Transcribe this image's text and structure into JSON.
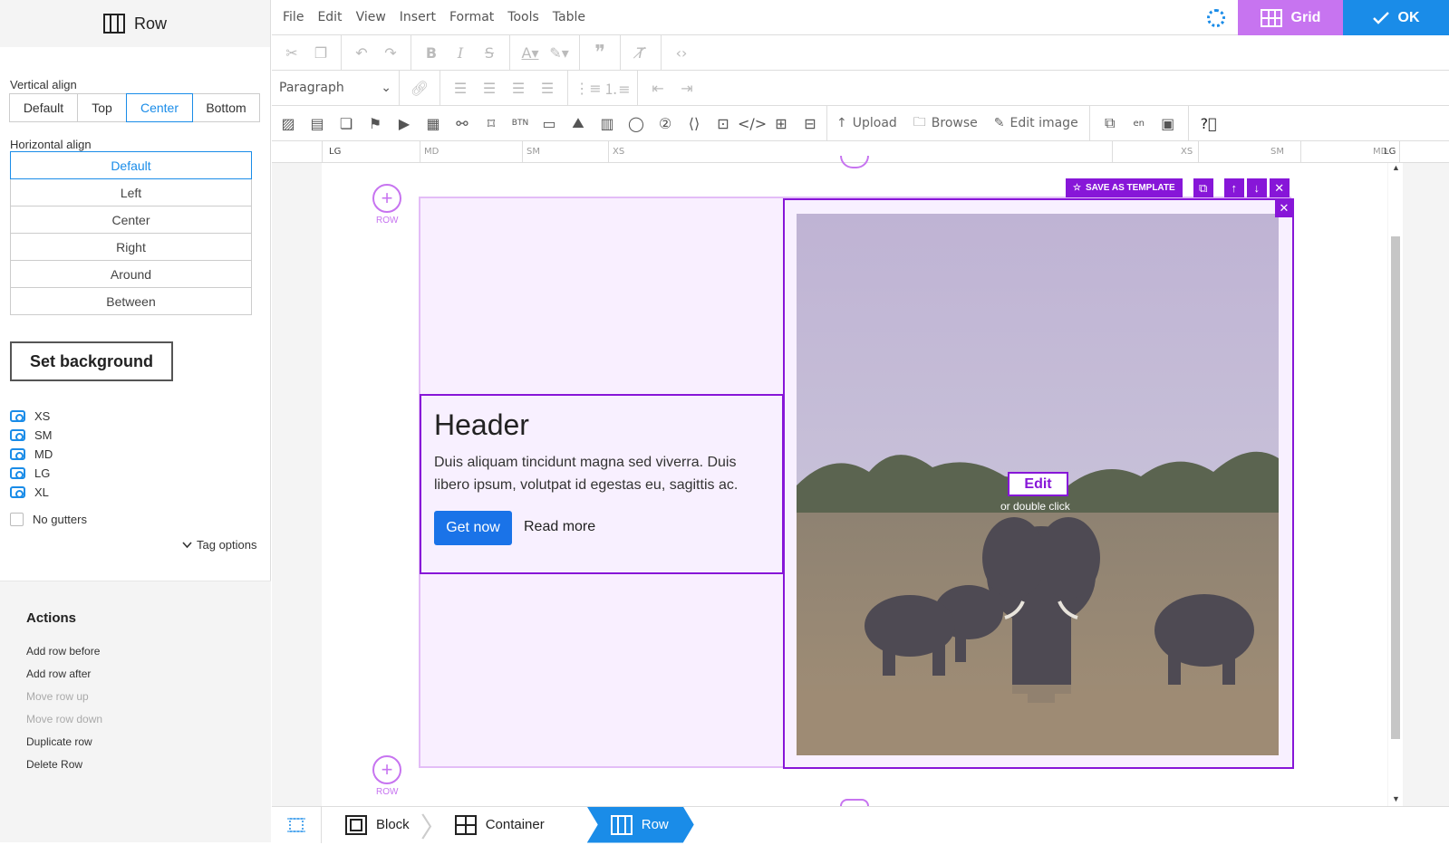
{
  "sidebar": {
    "title": "Row",
    "vertical_align": {
      "label": "Vertical align",
      "options": [
        "Default",
        "Top",
        "Center",
        "Bottom"
      ],
      "selected": "Center"
    },
    "horizontal_align": {
      "label": "Horizontal align",
      "options": [
        "Default",
        "Left",
        "Center",
        "Right",
        "Around",
        "Between"
      ],
      "selected": "Default"
    },
    "set_background_label": "Set background",
    "visibility": [
      "XS",
      "SM",
      "MD",
      "LG",
      "XL"
    ],
    "no_gutters_label": "No gutters",
    "tag_options_label": "Tag options",
    "actions": {
      "title": "Actions",
      "items": [
        {
          "label": "Add row before",
          "enabled": true
        },
        {
          "label": "Add row after",
          "enabled": true
        },
        {
          "label": "Move row up",
          "enabled": false
        },
        {
          "label": "Move row down",
          "enabled": false
        },
        {
          "label": "Duplicate row",
          "enabled": true
        },
        {
          "label": "Delete Row",
          "enabled": true
        }
      ]
    }
  },
  "menubar": {
    "items": [
      "File",
      "Edit",
      "View",
      "Insert",
      "Format",
      "Tools",
      "Table"
    ],
    "grid_label": "Grid",
    "ok_label": "OK"
  },
  "toolbar": {
    "paragraph_label": "Paragraph",
    "upload_label": "Upload",
    "browse_label": "Browse",
    "edit_image_label": "Edit image"
  },
  "ruler": {
    "labels": [
      "LG",
      "MD",
      "SM",
      "XS",
      "XS",
      "SM",
      "MD",
      "LG"
    ]
  },
  "content": {
    "row_label": "ROW",
    "header": "Header",
    "paragraph": "Duis aliquam tincidunt magna sed viverra. Duis libero ipsum, volutpat id egestas eu, sagittis ac.",
    "get_now_label": "Get now",
    "read_more_label": "Read more",
    "save_template_label": "SAVE AS TEMPLATE",
    "edit_label": "Edit",
    "double_click_label": "or double click"
  },
  "breadcrumb": {
    "items": [
      "Block",
      "Container",
      "Row"
    ],
    "active": "Row"
  },
  "colors": {
    "accent_blue": "#1a8ce8",
    "grid_purple": "#c774f0",
    "column_border": "#8716d8"
  }
}
